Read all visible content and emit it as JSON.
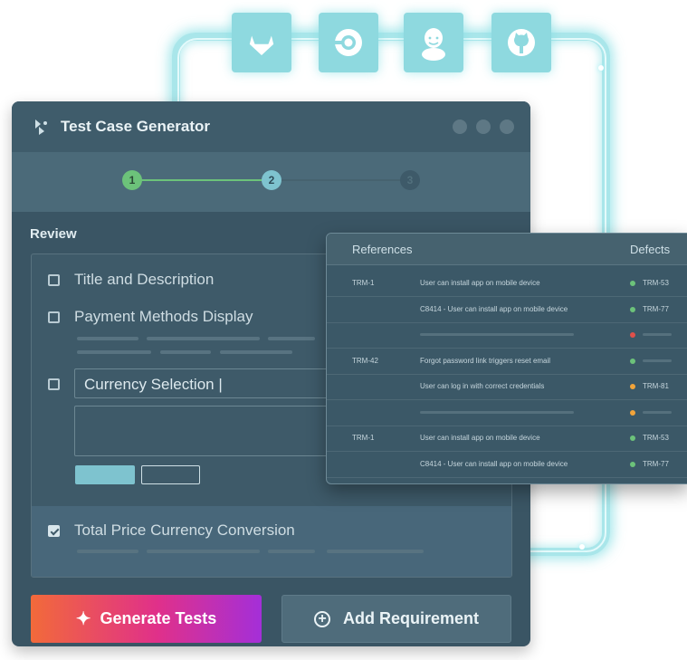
{
  "integrations": [
    {
      "name": "gitlab-icon"
    },
    {
      "name": "circleci-icon"
    },
    {
      "name": "jenkins-icon"
    },
    {
      "name": "github-icon"
    }
  ],
  "window": {
    "title": "Test Case Generator",
    "steps": [
      "1",
      "2",
      "3"
    ],
    "review_label": "Review"
  },
  "review": {
    "item1": "Title and Description",
    "item2": "Payment Methods Display",
    "item3_input": "Currency Selection |",
    "item4": "Total Price Currency Conversion"
  },
  "actions": {
    "generate": "Generate Tests",
    "add": "Add Requirement"
  },
  "references": {
    "col_references": "References",
    "col_defects": "Defects",
    "rows": [
      {
        "id": "TRM-1",
        "desc": "User can install app on mobile device",
        "status": "green",
        "defect": "TRM-53"
      },
      {
        "id": "",
        "desc": "C8414 - User can install app on mobile device",
        "status": "green",
        "defect": "TRM-77"
      },
      {
        "id": "",
        "desc": "",
        "status": "red",
        "defect": ""
      },
      {
        "id": "TRM-42",
        "desc": "Forgot password link triggers reset email",
        "status": "green",
        "defect": ""
      },
      {
        "id": "",
        "desc": "User can log in with correct credentials",
        "status": "orange",
        "defect": "TRM-81"
      },
      {
        "id": "",
        "desc": "",
        "status": "orange",
        "defect": ""
      },
      {
        "id": "TRM-1",
        "desc": "User can install app on mobile device",
        "status": "green",
        "defect": "TRM-53"
      },
      {
        "id": "",
        "desc": "C8414 - User can install app on mobile device",
        "status": "green",
        "defect": "TRM-77"
      }
    ]
  },
  "colors": {
    "green": "#6cc27a",
    "red": "#e0504a",
    "orange": "#f2a43a",
    "accent": "#7ec3cf"
  }
}
